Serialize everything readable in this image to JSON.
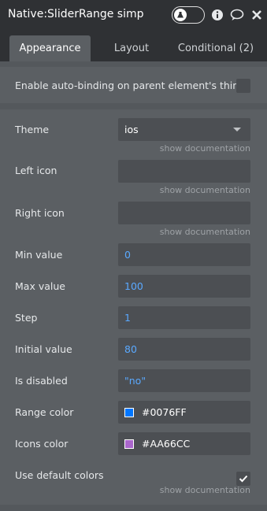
{
  "header": {
    "title": "Native:SliderRange simp",
    "icons": [
      "flask-icon",
      "info-icon",
      "comment-icon",
      "close-icon"
    ]
  },
  "tabs": [
    {
      "label": "Appearance",
      "active": true
    },
    {
      "label": "Layout",
      "active": false
    },
    {
      "label": "Conditional (2)",
      "active": false
    }
  ],
  "autobinding": {
    "label": "Enable auto-binding on parent element's thing",
    "checked": false
  },
  "doc_link": "show documentation",
  "properties": {
    "theme": {
      "label": "Theme",
      "value": "ios"
    },
    "left_icon": {
      "label": "Left icon",
      "value": ""
    },
    "right_icon": {
      "label": "Right icon",
      "value": ""
    },
    "min_value": {
      "label": "Min value",
      "value": "0"
    },
    "max_value": {
      "label": "Max value",
      "value": "100"
    },
    "step": {
      "label": "Step",
      "value": "1"
    },
    "initial_value": {
      "label": "Initial value",
      "value": "80"
    },
    "is_disabled": {
      "label": "Is disabled",
      "value": "\"no\""
    },
    "range_color": {
      "label": "Range color",
      "value": "#0076FF",
      "swatch": "#0076ff"
    },
    "icons_color": {
      "label": "Icons color",
      "value": "#AA66CC",
      "swatch": "#aa66cc"
    },
    "use_default_colors": {
      "label": "Use default colors",
      "checked": true
    }
  }
}
